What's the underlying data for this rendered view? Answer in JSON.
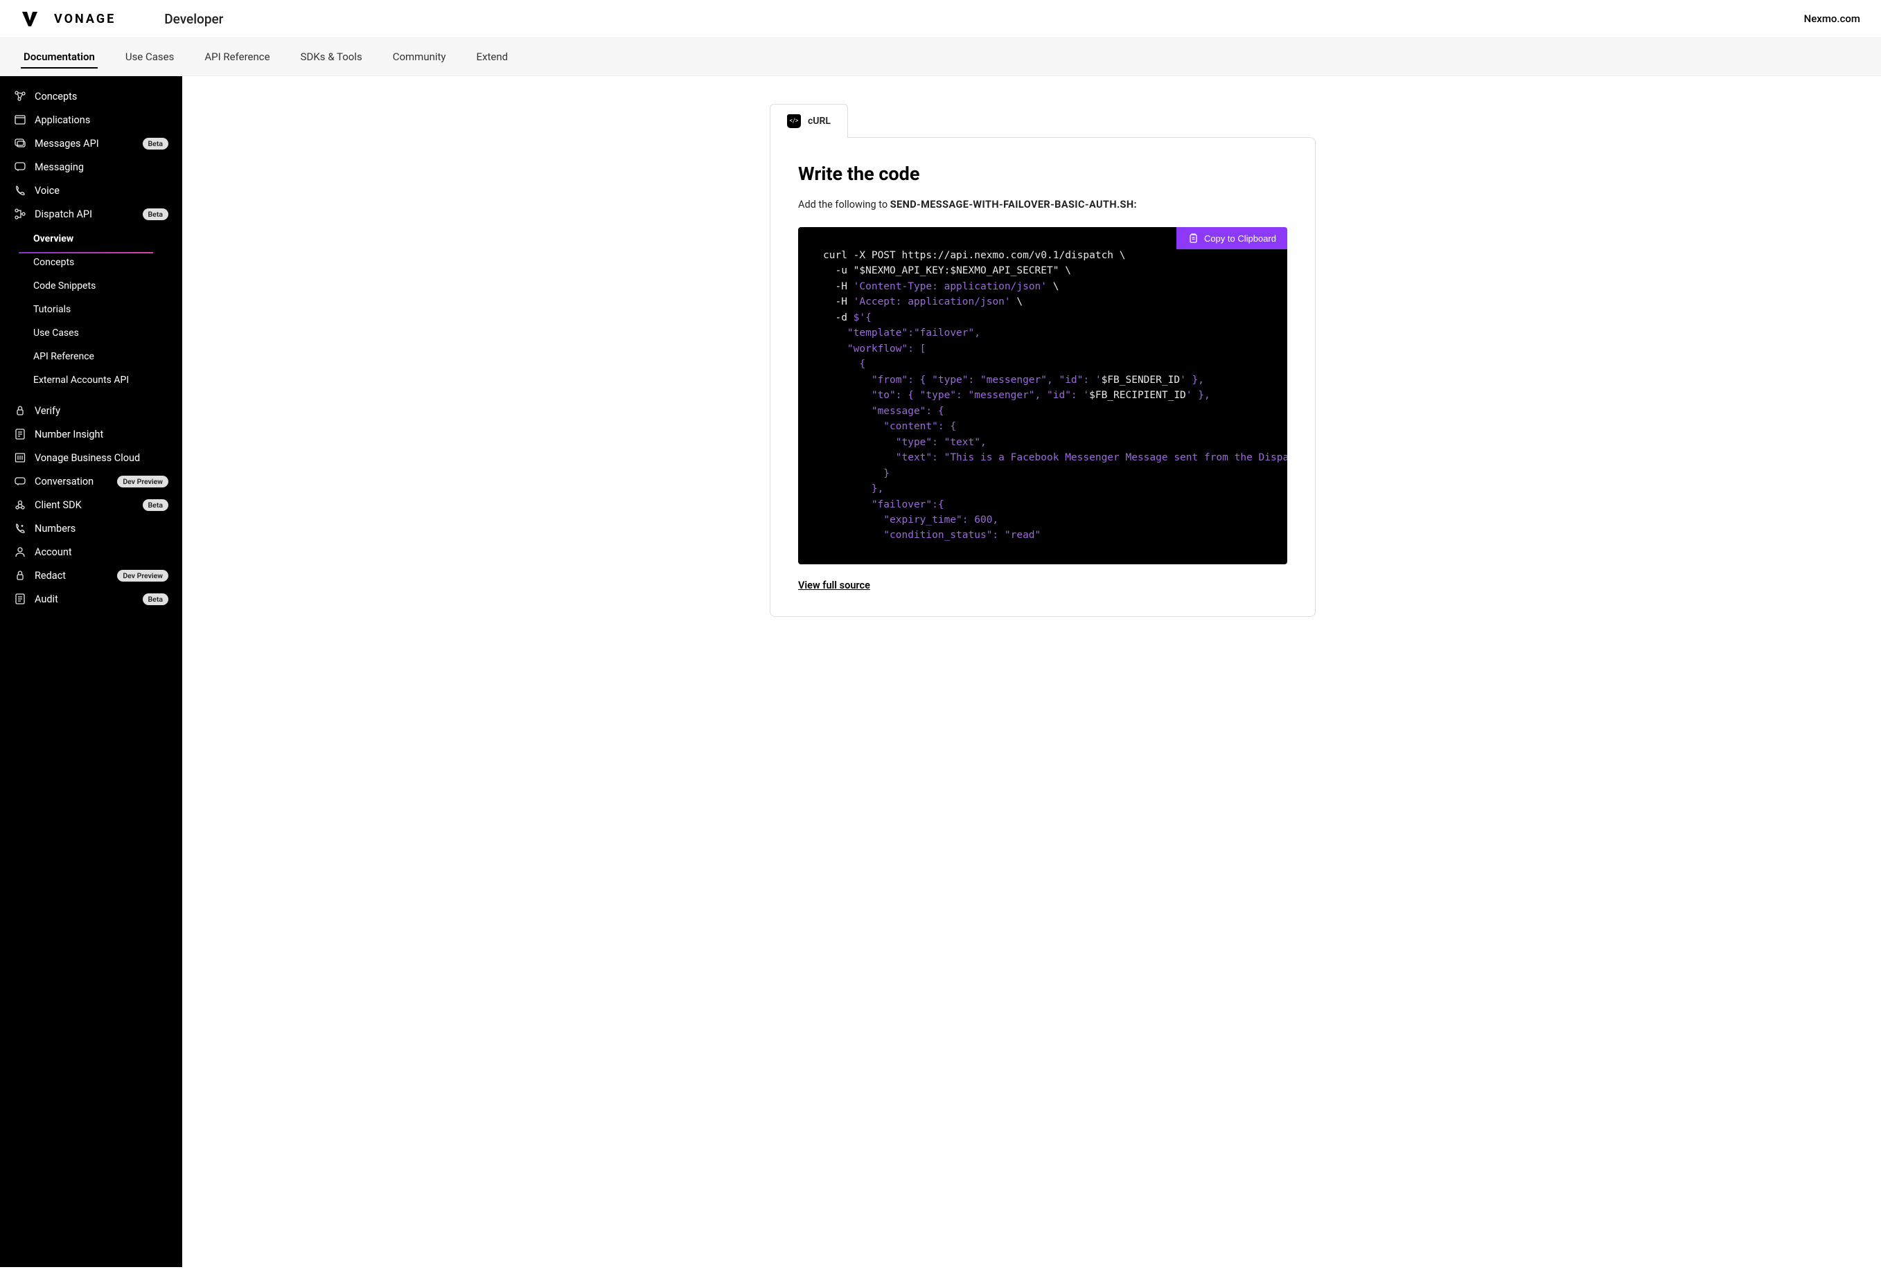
{
  "header": {
    "brand": "VONAGE",
    "dev_label": "Developer",
    "external_link": "Nexmo.com"
  },
  "topnav": {
    "documentation": "Documentation",
    "use_cases": "Use Cases",
    "api_reference": "API Reference",
    "sdks_tools": "SDKs & Tools",
    "community": "Community",
    "extend": "Extend"
  },
  "sidebar": {
    "concepts": "Concepts",
    "applications": "Applications",
    "messages_api": "Messages API",
    "messaging": "Messaging",
    "voice": "Voice",
    "dispatch_api": "Dispatch API",
    "verify": "Verify",
    "number_insight": "Number Insight",
    "vonage_business_cloud": "Vonage Business Cloud",
    "conversation": "Conversation",
    "client_sdk": "Client SDK",
    "numbers": "Numbers",
    "account": "Account",
    "redact": "Redact",
    "audit": "Audit",
    "badges": {
      "beta": "Beta",
      "dev_preview": "Dev Preview"
    },
    "sub": {
      "overview": "Overview",
      "concepts": "Concepts",
      "code_snippets": "Code Snippets",
      "tutorials": "Tutorials",
      "use_cases": "Use Cases",
      "api_reference": "API Reference",
      "external_accounts_api": "External Accounts API"
    }
  },
  "content": {
    "tab_label": "cURL",
    "heading": "Write the code",
    "instruction_prefix": "Add the following to ",
    "filename": "SEND-MESSAGE-WITH-FAILOVER-BASIC-AUTH.SH:",
    "copy_label": "Copy to Clipboard",
    "view_full": "View full source",
    "code": {
      "l1": "curl -X POST https://api.nexmo.com/v0.1/dispatch \\",
      "l2a": "  -u \"",
      "l2b": "$NEXMO_API_KEY:$NEXMO_API_SECRET",
      "l2c": "\" \\",
      "l3a": "  -H ",
      "l3b": "'Content-Type: application/json'",
      "l3c": " \\",
      "l4a": "  -H ",
      "l4b": "'Accept: application/json'",
      "l4c": " \\",
      "l5a": "  -d ",
      "l5b": "$'{",
      "l6": "    \"template\":\"failover\",",
      "l7": "    \"workflow\": [",
      "l8": "      {",
      "l9a": "        \"from\": { \"type\": \"messenger\", \"id\": '",
      "l9b": "$FB_SENDER_ID",
      "l9c": "' },",
      "l10a": "        \"to\": { \"type\": \"messenger\", \"id\": '",
      "l10b": "$FB_RECIPIENT_ID",
      "l10c": "' },",
      "l11": "        \"message\": {",
      "l12": "          \"content\": {",
      "l13": "            \"type\": \"text\",",
      "l14": "            \"text\": \"This is a Facebook Messenger Message sent from the Dispatch API\"",
      "l15": "          }",
      "l16": "        },",
      "l17": "        \"failover\":{",
      "l18": "          \"expiry_time\": 600,",
      "l19": "          \"condition_status\": \"read\""
    }
  }
}
